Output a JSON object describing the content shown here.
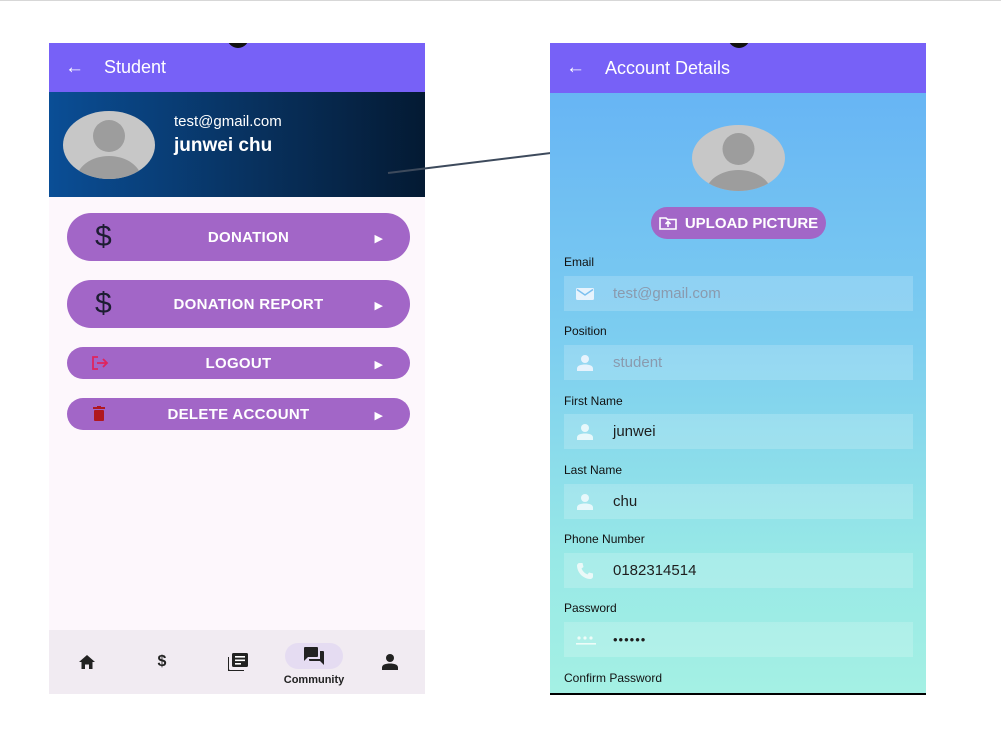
{
  "left_screen": {
    "appbar": {
      "back_icon": "arrow-left-icon",
      "title": "Student"
    },
    "profile": {
      "email": "test@gmail.com",
      "name": "junwei chu"
    },
    "menu": [
      {
        "label": "DONATION",
        "icon": "dollar-icon",
        "arrow": "▶"
      },
      {
        "label": "DONATION REPORT",
        "icon": "dollar-icon",
        "arrow": "▶"
      },
      {
        "label": "LOGOUT",
        "icon": "logout-icon",
        "arrow": "▶"
      },
      {
        "label": "DELETE ACCOUNT",
        "icon": "trash-icon",
        "arrow": "▶"
      }
    ],
    "menu_icon_text": {
      "dollar": "$"
    },
    "bottom_nav": [
      {
        "icon": "home-icon"
      },
      {
        "icon": "dollar-icon",
        "glyph": "$"
      },
      {
        "icon": "news-icon"
      },
      {
        "icon": "forum-icon",
        "label": "Community",
        "selected": true
      },
      {
        "icon": "person-icon"
      }
    ]
  },
  "right_screen": {
    "appbar": {
      "back_icon": "arrow-left-icon",
      "title": "Account Details"
    },
    "upload_button": {
      "label": "UPLOAD PICTURE",
      "icon": "upload-folder-icon"
    },
    "fields": [
      {
        "label": "Email",
        "value": "test@gmail.com",
        "icon": "mail-icon",
        "muted": true
      },
      {
        "label": "Position",
        "value": "student",
        "icon": "person-icon",
        "muted": true
      },
      {
        "label": "First Name",
        "value": "junwei",
        "icon": "person-icon",
        "muted": false
      },
      {
        "label": "Last Name",
        "value": "chu",
        "icon": "person-icon",
        "muted": false
      },
      {
        "label": "Phone Number",
        "value": "0182314514",
        "icon": "phone-icon",
        "muted": false
      },
      {
        "label": "Password",
        "value": "••••••",
        "icon": "password-icon",
        "muted": false
      }
    ],
    "trailing_label": "Confirm Password"
  },
  "colors": {
    "appbar": "#7761f7",
    "button": "#a266c7",
    "header_gradient_start": "#0a4e96",
    "header_gradient_end": "#041a33",
    "logout_icon": "#e0245e",
    "trash_icon": "#b0181f"
  }
}
